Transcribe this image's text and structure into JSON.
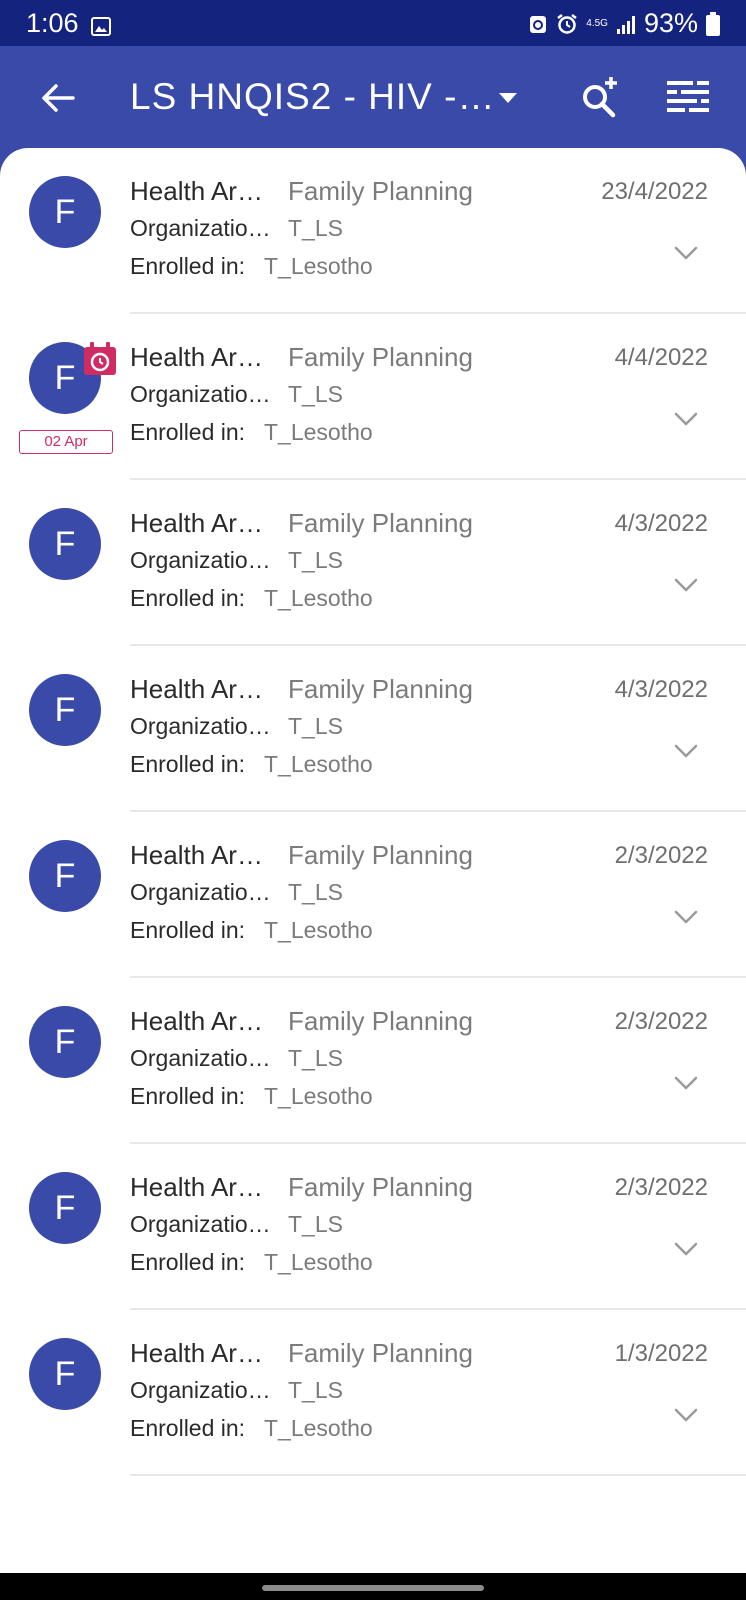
{
  "status_bar": {
    "time": "1:06",
    "network": "4.5G",
    "battery": "93%"
  },
  "app_bar": {
    "title": "LS HNQIS2 - HIV -…",
    "icons": {
      "back": "arrow-back-icon",
      "dropdown": "dropdown-icon",
      "search": "search-add-icon",
      "filter": "filter-icon"
    }
  },
  "colors": {
    "primary": "#3a4aa8",
    "status_bar": "#13237e",
    "overdue_accent": "#d12b63",
    "text_dark": "#2a2a2a",
    "text_gray": "#7b7b7b"
  },
  "records": [
    {
      "avatar": "F",
      "attr1_label": "Health Ar…",
      "attr1_value": "Family Planning",
      "attr2_label": "Organizatio…",
      "attr2_value": "T_LS",
      "enrolled_label": "Enrolled in:",
      "enrolled_value": "T_Lesotho",
      "date": "23/4/2022"
    },
    {
      "avatar": "F",
      "attr1_label": "Health Ar…",
      "attr1_value": "Family Planning",
      "attr2_label": "Organizatio…",
      "attr2_value": "T_LS",
      "enrolled_label": "Enrolled in:",
      "enrolled_value": "T_Lesotho",
      "date": "4/4/2022",
      "overdue_tag": "02 Apr"
    },
    {
      "avatar": "F",
      "attr1_label": "Health Ar…",
      "attr1_value": "Family Planning",
      "attr2_label": "Organizatio…",
      "attr2_value": "T_LS",
      "enrolled_label": "Enrolled in:",
      "enrolled_value": "T_Lesotho",
      "date": "4/3/2022"
    },
    {
      "avatar": "F",
      "attr1_label": "Health Ar…",
      "attr1_value": "Family Planning",
      "attr2_label": "Organizatio…",
      "attr2_value": "T_LS",
      "enrolled_label": "Enrolled in:",
      "enrolled_value": "T_Lesotho",
      "date": "4/3/2022"
    },
    {
      "avatar": "F",
      "attr1_label": "Health Ar…",
      "attr1_value": "Family Planning",
      "attr2_label": "Organizatio…",
      "attr2_value": "T_LS",
      "enrolled_label": "Enrolled in:",
      "enrolled_value": "T_Lesotho",
      "date": "2/3/2022"
    },
    {
      "avatar": "F",
      "attr1_label": "Health Ar…",
      "attr1_value": "Family Planning",
      "attr2_label": "Organizatio…",
      "attr2_value": "T_LS",
      "enrolled_label": "Enrolled in:",
      "enrolled_value": "T_Lesotho",
      "date": "2/3/2022"
    },
    {
      "avatar": "F",
      "attr1_label": "Health Ar…",
      "attr1_value": "Family Planning",
      "attr2_label": "Organizatio…",
      "attr2_value": "T_LS",
      "enrolled_label": "Enrolled in:",
      "enrolled_value": "T_Lesotho",
      "date": "2/3/2022"
    },
    {
      "avatar": "F",
      "attr1_label": "Health Ar…",
      "attr1_value": "Family Planning",
      "attr2_label": "Organizatio…",
      "attr2_value": "T_LS",
      "enrolled_label": "Enrolled in:",
      "enrolled_value": "T_Lesotho",
      "date": "1/3/2022"
    }
  ]
}
